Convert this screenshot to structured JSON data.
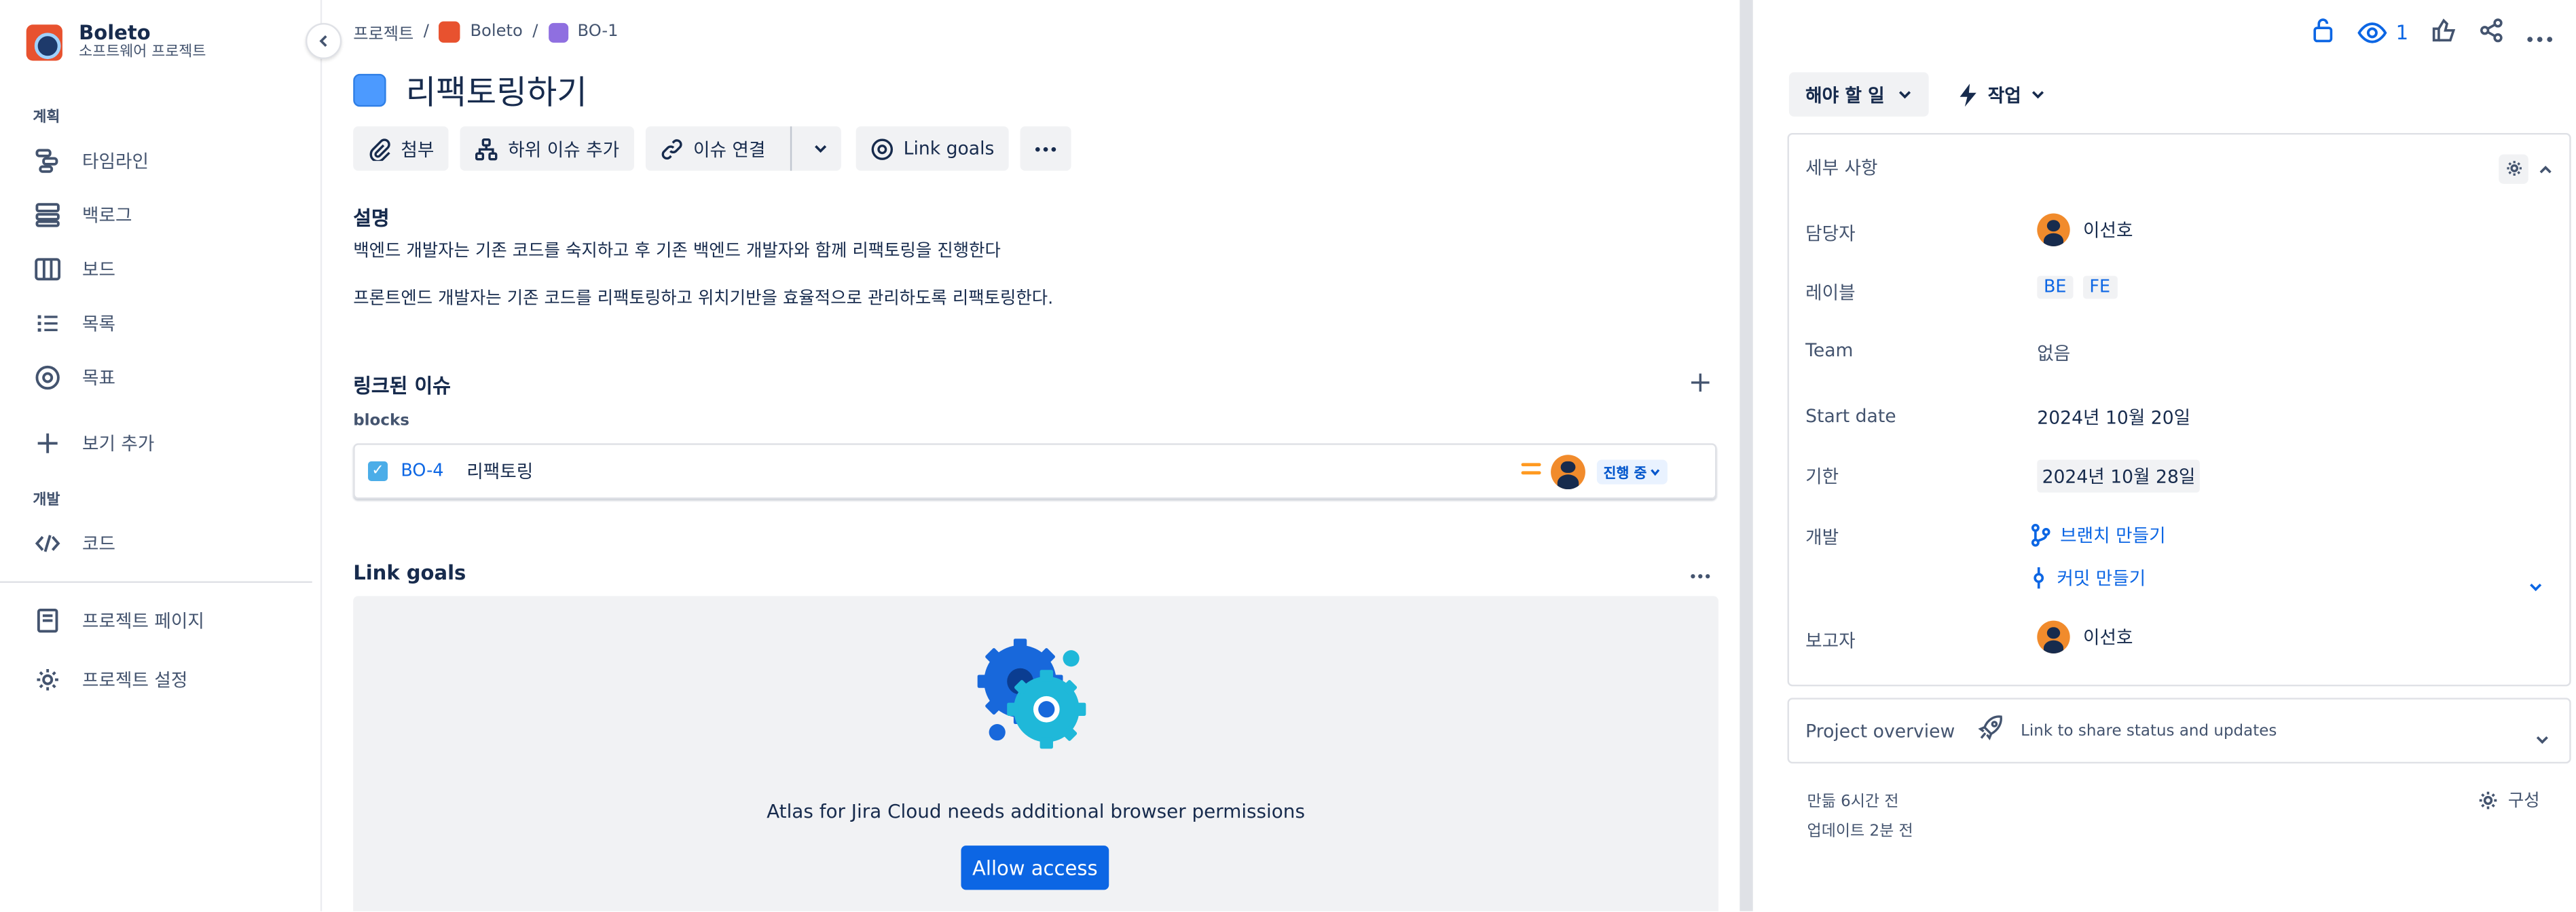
{
  "project": {
    "name": "Boleto",
    "type": "소프트웨어 프로젝트"
  },
  "sidebar": {
    "section_plan": "계획",
    "section_dev": "개발",
    "items": [
      {
        "label": "타임라인",
        "icon": "timeline-icon"
      },
      {
        "label": "백로그",
        "icon": "backlog-icon"
      },
      {
        "label": "보드",
        "icon": "board-icon"
      },
      {
        "label": "목록",
        "icon": "list-icon"
      },
      {
        "label": "목표",
        "icon": "goal-icon"
      },
      {
        "label": "보기 추가",
        "icon": "plus-icon"
      },
      {
        "label": "코드",
        "icon": "code-icon"
      },
      {
        "label": "프로젝트 페이지",
        "icon": "page-icon"
      },
      {
        "label": "프로젝트 설정",
        "icon": "gear-icon"
      }
    ]
  },
  "breadcrumb": {
    "root": "프로젝트",
    "project": "Boleto",
    "issue": "BO-1"
  },
  "issue": {
    "title": "리팩토링하기",
    "toolbar": {
      "attach": "첨부",
      "add_child": "하위 이슈 추가",
      "link_issue": "이슈 연결",
      "link_goals": "Link goals"
    },
    "description_heading": "설명",
    "description": [
      "백엔드 개발자는 기존 코드를 숙지하고 후 기존 백엔드 개발자와 함께 리팩토링을 진행한다",
      "프론트엔드 개발자는 기존 코드를 리팩토링하고 위치기반을 효율적으로 관리하도록 리팩토링한다."
    ],
    "linked_heading": "링크된 이슈",
    "link_type": "blocks",
    "linked": {
      "key": "BO-4",
      "summary": "리팩토링",
      "status": "진행 중"
    },
    "goals_heading": "Link goals",
    "goals_message": "Atlas for Jira Cloud needs additional browser permissions",
    "allow_label": "Allow access"
  },
  "right": {
    "watch_count": "1",
    "status": "해야 할 일",
    "action": "작업",
    "details_heading": "세부 사항",
    "fields": {
      "assignee_label": "담당자",
      "assignee": "이선호",
      "labels_label": "레이블",
      "labels": [
        "BE",
        "FE"
      ],
      "team_label": "Team",
      "team": "없음",
      "start_label": "Start date",
      "start": "2024년 10월 20일",
      "due_label": "기한",
      "due": "2024년 10월 28일",
      "dev_label": "개발",
      "dev_branch": "브랜치 만들기",
      "dev_commit": "커밋 만들기",
      "reporter_label": "보고자",
      "reporter": "이선호"
    },
    "overview_title": "Project overview",
    "overview_sub": "Link to share status and updates",
    "created": "만듦 6시간 전",
    "updated": "업데이트 2분 전",
    "configure": "구성"
  },
  "colors": {
    "accent": "#0c66e4",
    "project_avatar": "#e8522f",
    "priority": "#ff991f"
  }
}
